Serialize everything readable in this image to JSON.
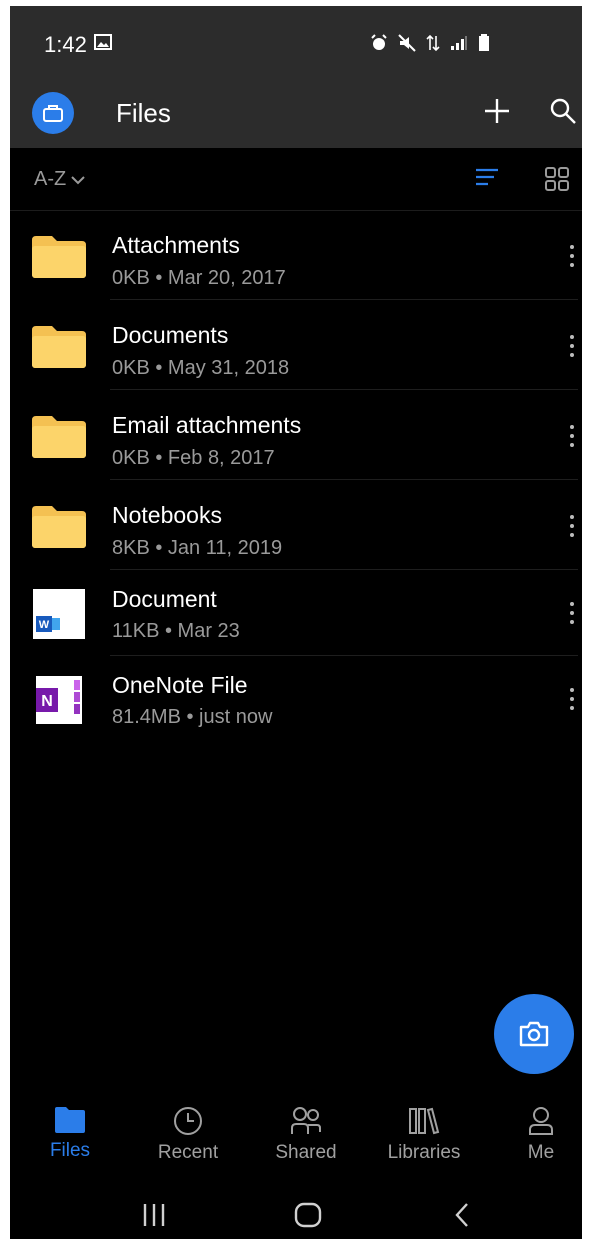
{
  "status_bar": {
    "time": "1:42"
  },
  "app_bar": {
    "title": "Files"
  },
  "toolbar": {
    "sort_label": "A-Z"
  },
  "files": [
    {
      "name": "Attachments",
      "meta": "0KB • Mar 20, 2017",
      "type": "folder"
    },
    {
      "name": "Documents",
      "meta": "0KB • May 31, 2018",
      "type": "folder"
    },
    {
      "name": "Email attachments",
      "meta": "0KB • Feb 8, 2017",
      "type": "folder"
    },
    {
      "name": "Notebooks",
      "meta": "8KB • Jan 11, 2019",
      "type": "folder"
    },
    {
      "name": "Document",
      "meta": "11KB • Mar 23",
      "type": "word-document"
    },
    {
      "name": "OneNote File",
      "meta": "81.4MB • just now",
      "type": "onenote"
    }
  ],
  "bottom_nav": [
    {
      "label": "Files",
      "icon": "folder-icon",
      "active": true
    },
    {
      "label": "Recent",
      "icon": "clock-icon",
      "active": false
    },
    {
      "label": "Shared",
      "icon": "people-icon",
      "active": false
    },
    {
      "label": "Libraries",
      "icon": "library-icon",
      "active": false
    },
    {
      "label": "Me",
      "icon": "person-icon",
      "active": false
    }
  ],
  "colors": {
    "accent": "#2b7de9",
    "folder": "#fcd46a",
    "app_bar": "#2c2c2c",
    "background": "#000000",
    "secondary_text": "#9a9a9a",
    "onenote": "#7719aa"
  }
}
